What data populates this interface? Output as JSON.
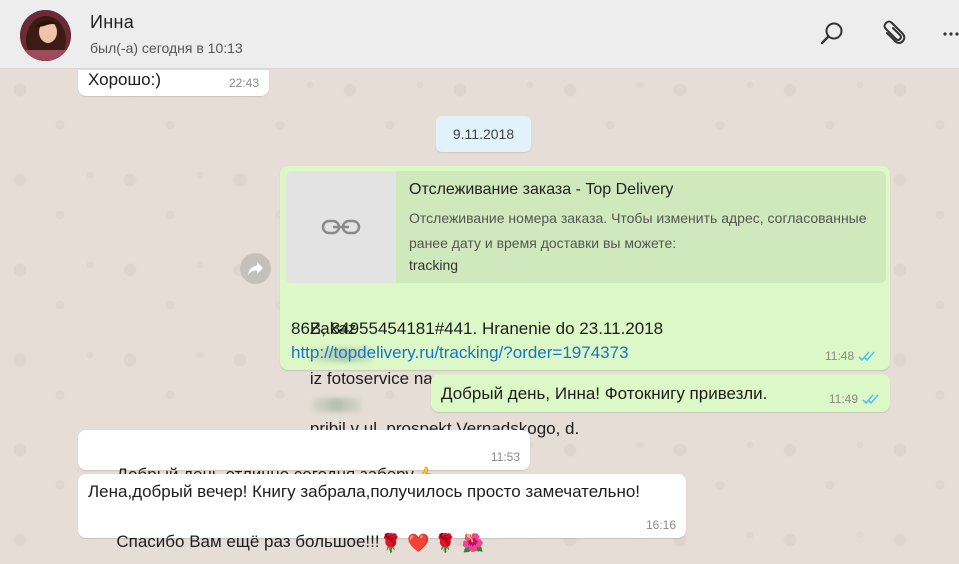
{
  "header": {
    "name": "Инна",
    "status": "был(-а) сегодня в 10:13"
  },
  "date_separator": "9.11.2018",
  "messages": [
    {
      "id": 0,
      "text": "Хорошо:)",
      "time": "22:43",
      "direction": "in"
    },
    {
      "id": 1,
      "direction": "out",
      "time": "11:48",
      "read": true,
      "preview": {
        "title": "Отслеживание заказа - Top Delivery",
        "description": "Отслеживание номера заказа. Чтобы изменить адрес, согласованные ранее дату и время доставки вы можете:",
        "domain": "tracking"
      },
      "text_part1": "Zakaz",
      "text_part2": "iz fotoservice na",
      "text_part3": "pribil v ul. prospekt Vernadskogo, d.",
      "text_line2": "86B, 84955454181#441. Hranenie do 23.11.2018",
      "link": "http://topdelivery.ru/tracking/?order=1974373"
    },
    {
      "id": 2,
      "text": "Добрый день, Инна! Фотокнигу привезли.",
      "time": "11:49",
      "direction": "out",
      "read": true
    },
    {
      "id": 3,
      "text": "Добрый день,отлично,сегодня заберу",
      "emoji": "👍",
      "time": "11:53",
      "direction": "in"
    },
    {
      "id": 4,
      "line1": "Лена,добрый вечер! Книгу забрала,получилось просто замечательно!",
      "line2": "Спасибо Вам ещё раз большое!!!",
      "emojis": "🌹 ❤️ 🌹 🌺",
      "time": "16:16",
      "direction": "in"
    }
  ],
  "icons": {
    "search": "search-icon",
    "attach": "paperclip-icon",
    "menu": "more-vertical-icon",
    "forward": "forward-icon",
    "link": "link-icon",
    "read_ticks": "double-check-icon"
  },
  "colors": {
    "incoming_bubble": "#ffffff",
    "outgoing_bubble": "#dcf8c6",
    "read_ticks": "#4fc3f7",
    "link": "#1a73c8",
    "date_pill": "#e1f2fb"
  }
}
